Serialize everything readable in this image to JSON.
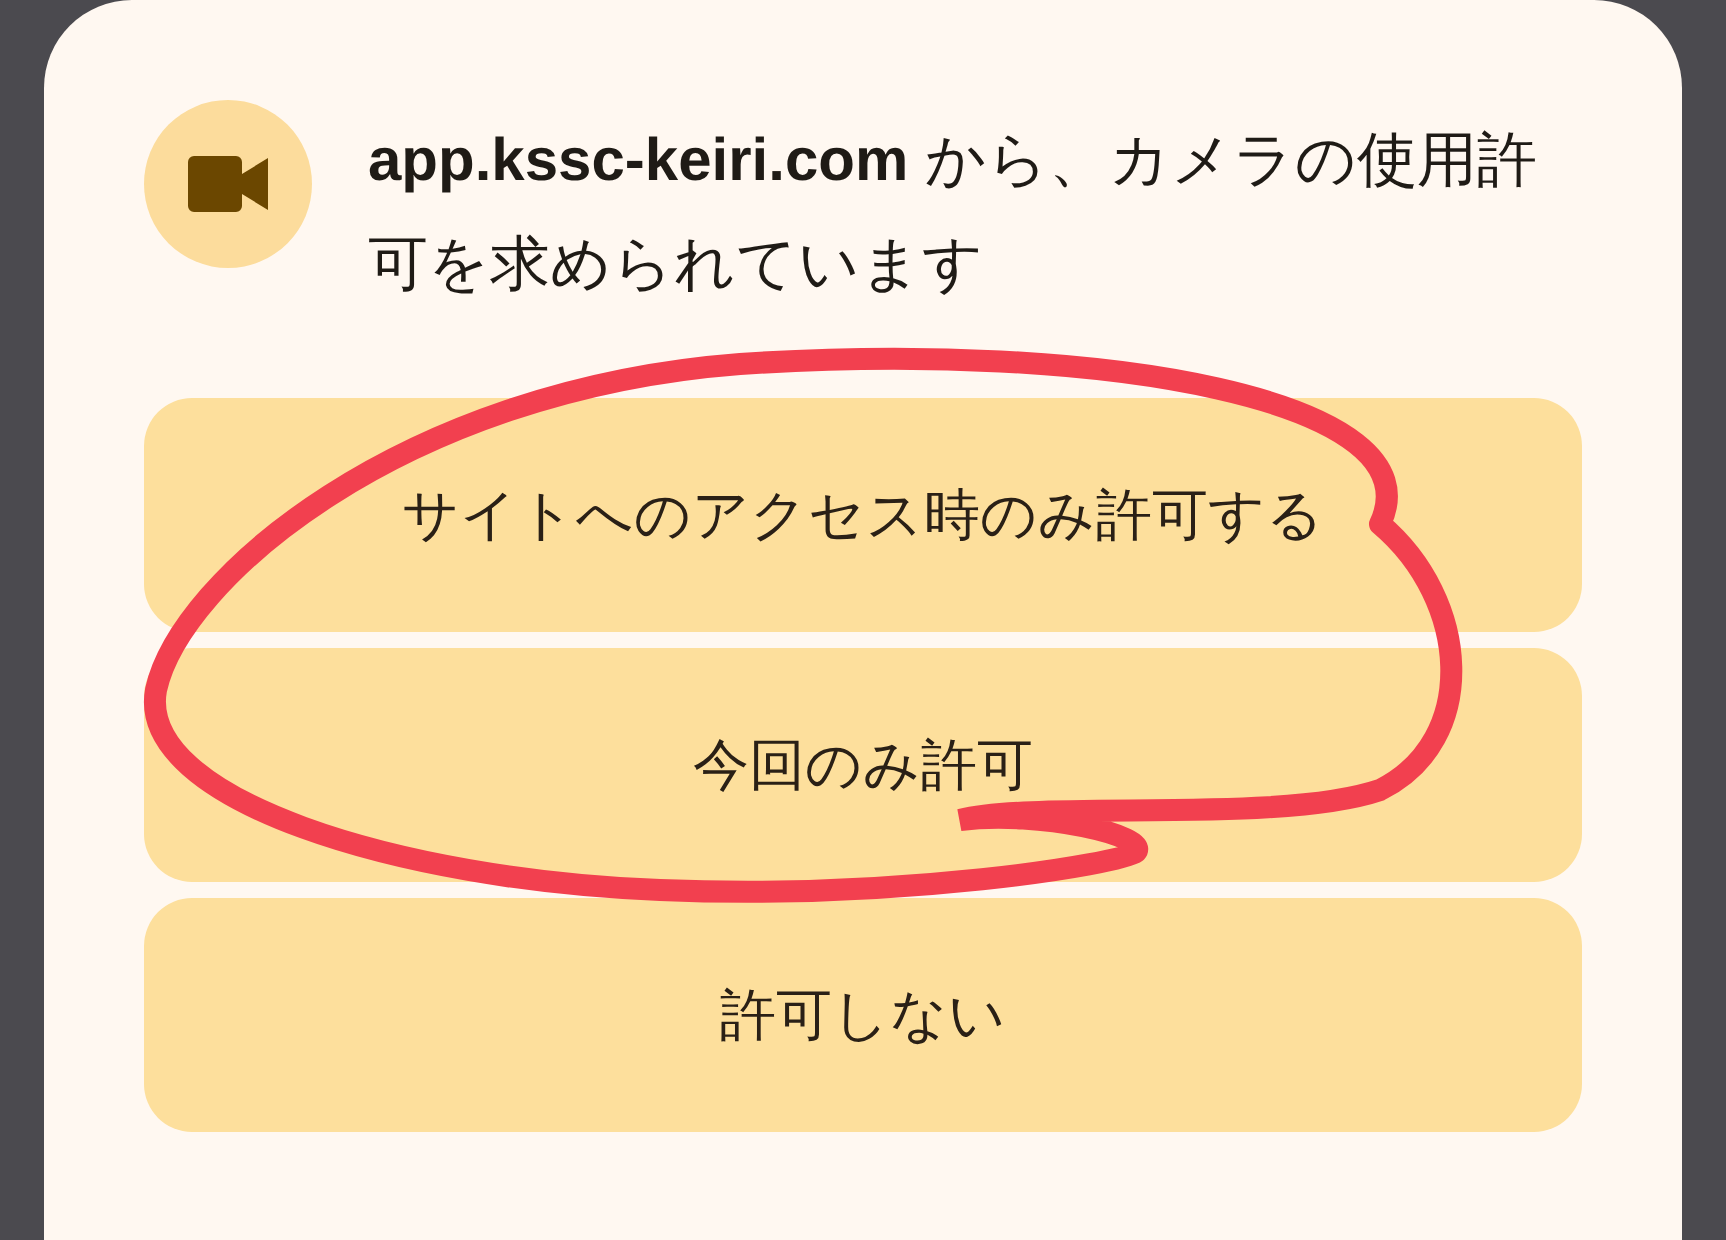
{
  "dialog": {
    "title": "**app.kssc-keiri.com** から、カメラの使用許可を求められています",
    "buttons": [
      {
        "label": "サイトへのアクセス時のみ許可する"
      },
      {
        "label": "今回のみ許可"
      },
      {
        "label": "許可しない"
      }
    ]
  }
}
